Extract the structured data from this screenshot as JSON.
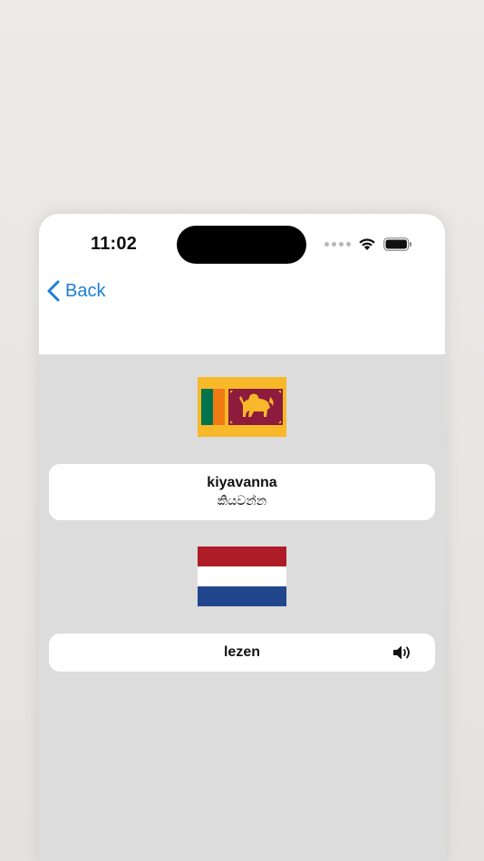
{
  "status_bar": {
    "time": "11:02"
  },
  "nav": {
    "back_label": "Back"
  },
  "source": {
    "flag_icon": "sri-lanka-flag-icon",
    "word": "kiyavanna",
    "native": "කියවන්න"
  },
  "target": {
    "flag_icon": "netherlands-flag-icon",
    "word": "lezen",
    "audio_icon": "speaker-icon"
  },
  "colors": {
    "accent": "#1e7fd8",
    "background": "#dcdcdc",
    "card": "#ffffff"
  }
}
